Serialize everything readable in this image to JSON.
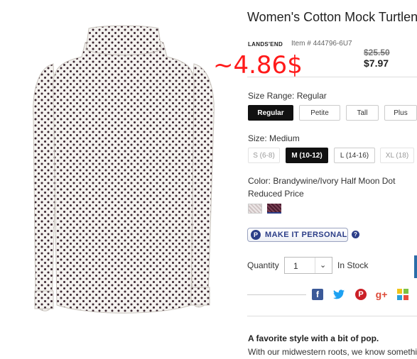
{
  "product": {
    "title": "Women's Cotton Mock Turtleneck",
    "brand": "LANDS'END",
    "item_number": "Item # 444796-6U7",
    "old_price": "$25.50",
    "new_price": "$7.97"
  },
  "annotation": "~4.86$",
  "size_range": {
    "label": "Size Range:",
    "value": "Regular",
    "options": [
      "Regular",
      "Petite",
      "Tall",
      "Plus"
    ],
    "selected": "Regular"
  },
  "size": {
    "label": "Size:",
    "value": "Medium",
    "options": [
      "S (6-8)",
      "M (10-12)",
      "L (14-16)",
      "XL (18)"
    ],
    "selected": "M (10-12)"
  },
  "color": {
    "label": "Color:",
    "value": "Brandywine/Ivory Half Moon Dot",
    "note": "Reduced Price",
    "swatch_colors": [
      "#d9cfcf",
      "#4a1c2e"
    ]
  },
  "personal": {
    "icon_letter": "P",
    "label": "MAKE IT PERSONAL",
    "help_glyph": "?"
  },
  "quantity": {
    "label": "Quantity",
    "value": "1",
    "stock": "In Stock"
  },
  "social": {
    "icons": [
      "facebook-icon",
      "twitter-icon",
      "pinterest-icon",
      "google-plus-icon",
      "more-share-icon"
    ],
    "glyphs": [
      "f",
      "t",
      "P",
      "g+",
      ""
    ]
  },
  "description": {
    "title": "A favorite style with a bit of pop.",
    "text": "With our midwestern roots, we know something"
  },
  "colors": {
    "accent": "#2c3e88",
    "annotation": "#ff1a1a",
    "facebook": "#3b5998",
    "twitter": "#1da1f2",
    "pinterest": "#cb2027",
    "google": "#dd4b39"
  }
}
